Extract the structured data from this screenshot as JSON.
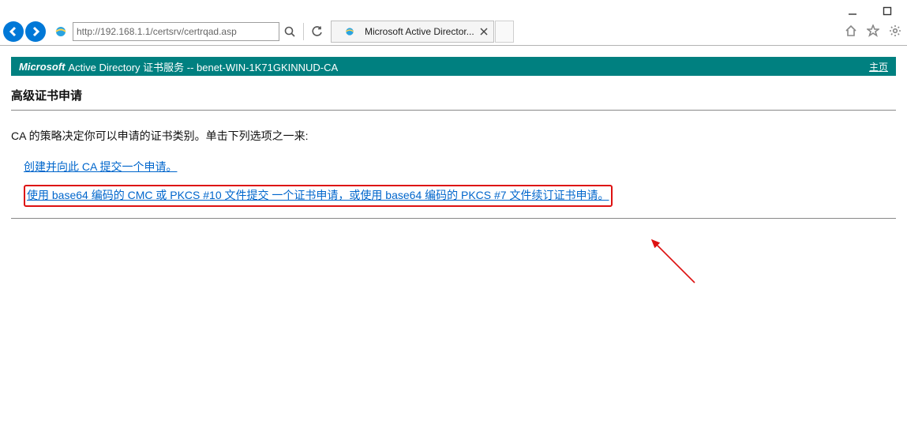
{
  "window": {
    "minimize_icon": "minimize-icon",
    "maximize_icon": "maximize-icon",
    "close_icon": "close-icon"
  },
  "toolbar": {
    "url": "http://192.168.1.1/certsrv/certrqad.asp",
    "search_icon": "search-icon",
    "refresh_icon": "refresh-icon",
    "home_icon": "home-icon",
    "star_icon": "star-icon",
    "gear_icon": "gear-icon"
  },
  "tab": {
    "title": "Microsoft Active Director...",
    "close_icon": "close-icon"
  },
  "banner": {
    "brand": "Microsoft",
    "service_text": " Active Directory 证书服务  --  benet-WIN-1K71GKINNUD-CA",
    "home_link": "主页"
  },
  "content": {
    "heading": "高级证书申请",
    "intro": "CA 的策略决定你可以申请的证书类别。单击下列选项之一来:",
    "option1": "创建并向此 CA 提交一个申请。",
    "option2": "使用 base64 编码的 CMC 或 PKCS #10 文件提交 一个证书申请，或使用 base64 编码的 PKCS #7 文件续订证书申请。"
  }
}
